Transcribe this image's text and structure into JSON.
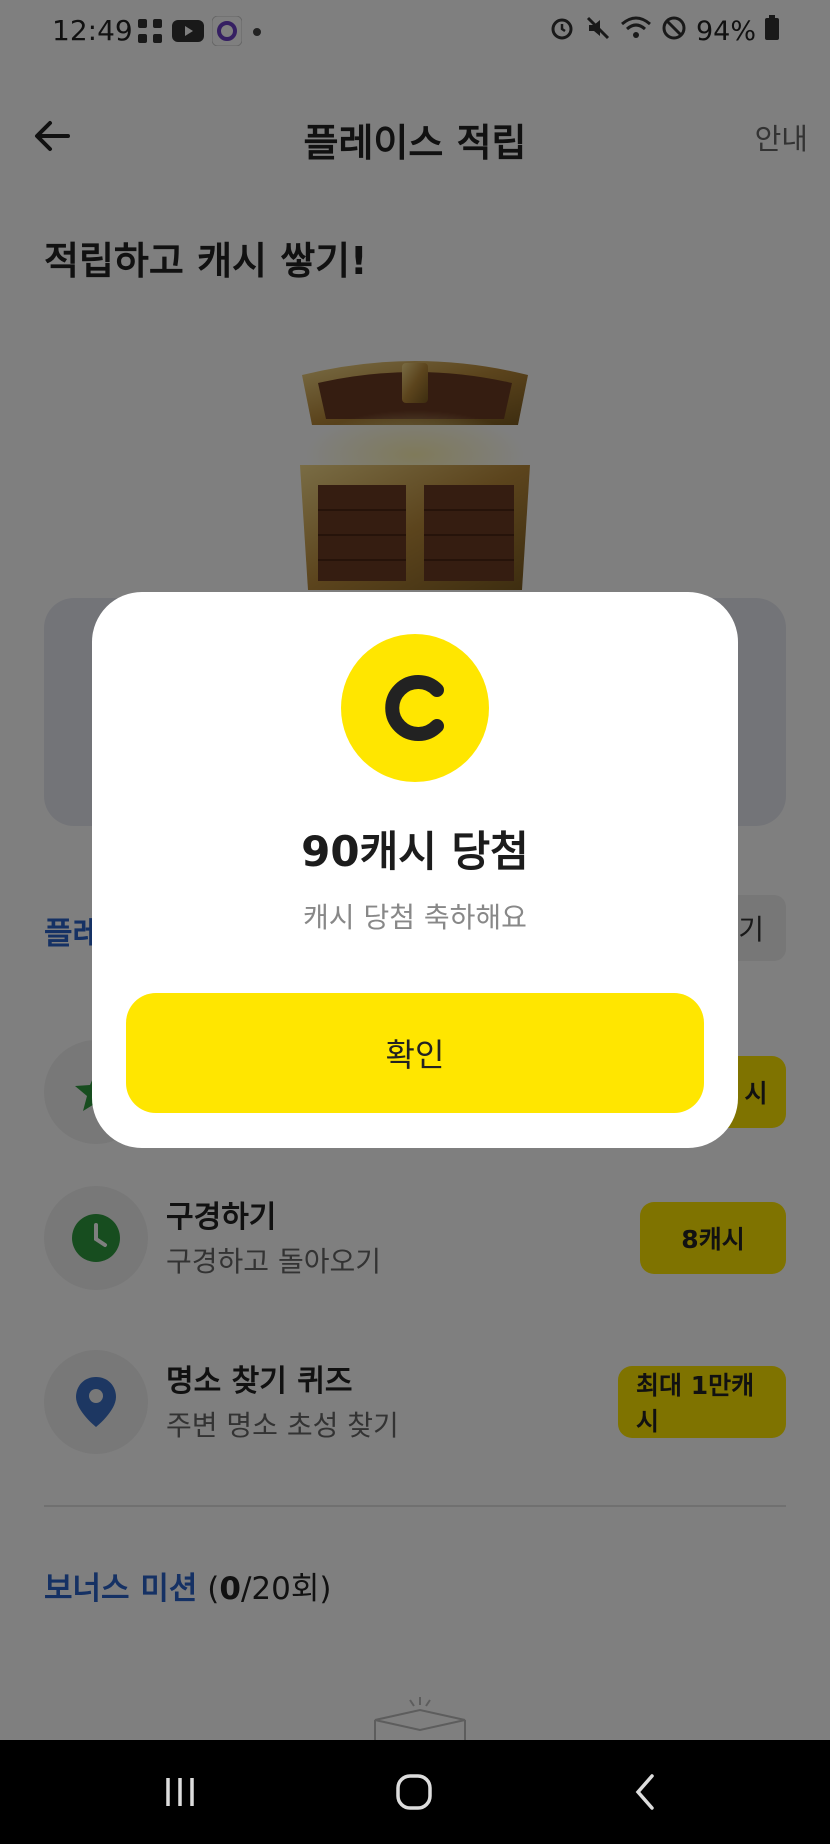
{
  "status_bar": {
    "time": "12:49",
    "battery": "94%",
    "left_icons": [
      "qr-icon",
      "youtube-icon",
      "app-circle-icon",
      "dot-icon"
    ],
    "right_icons": [
      "alarm-icon",
      "mute-icon",
      "wifi-icon",
      "do-not-disturb-icon",
      "battery-icon"
    ]
  },
  "header": {
    "title": "플레이스 적립",
    "guide_label": "안내"
  },
  "hero": {
    "title": "적립하고 캐시 쌓기!"
  },
  "missions_section": {
    "title": "플레",
    "button_label": "기"
  },
  "missions": [
    {
      "title": "",
      "subtitle": "",
      "reward": "시",
      "icon": "star-icon"
    },
    {
      "title": "구경하기",
      "subtitle": "구경하고 돌아오기",
      "reward": "8캐시",
      "icon": "clock-icon"
    },
    {
      "title": "명소 찾기 퀴즈",
      "subtitle": "주변 명소 초성 찾기",
      "reward": "최대 1만캐시",
      "icon": "location-pin-icon"
    }
  ],
  "bonus": {
    "label": "보너스 미션",
    "count_open": " (",
    "count": "0",
    "count_rest": "/20회)"
  },
  "dialog": {
    "coin_letter": "C",
    "title": "90캐시 당첨",
    "subtitle": "캐시 당첨 축하해요",
    "confirm_label": "확인"
  },
  "colors": {
    "accent_yellow": "#ffe600",
    "accent_blue": "#2b62c8",
    "green": "#2e9b3e",
    "pin_blue": "#3a6fc4"
  }
}
